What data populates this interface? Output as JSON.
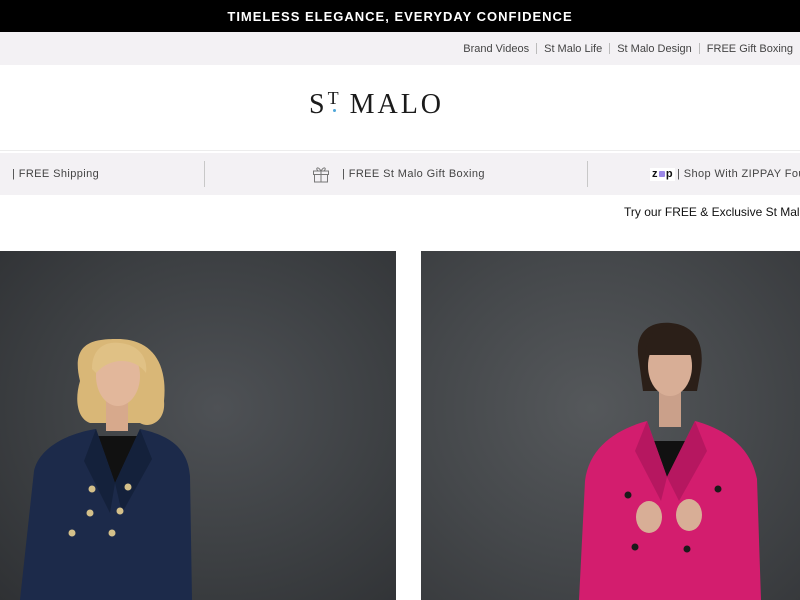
{
  "announcement": {
    "text": "TIMELESS ELEGANCE, EVERYDAY CONFIDENCE"
  },
  "utility_nav": {
    "items": [
      "Brand Videos",
      "St Malo Life",
      "St Malo Design",
      "FREE Gift Boxing"
    ]
  },
  "logo": {
    "st": "S",
    "t": "T",
    "name": "MALO",
    "dot_color": "#4fa7d8"
  },
  "usp_bar": {
    "shipping": "| FREE Shipping",
    "gift_boxing": "| FREE St Malo Gift Boxing",
    "zip_brand": "zip",
    "zippay": "| Shop With ZIPPAY Fou"
  },
  "promo": {
    "text": "Try our FREE & Exclusive St Malo I"
  },
  "hero": {
    "left": {
      "image": "model-navy-blazer",
      "blazer_color": "#1c2a4a"
    },
    "right": {
      "image": "model-pink-blazer",
      "blazer_color": "#d31d6e"
    }
  },
  "colors": {
    "announce_bg": "#000000",
    "utility_bg": "#f3f1f4",
    "usp_bg": "#f3f1f4"
  }
}
